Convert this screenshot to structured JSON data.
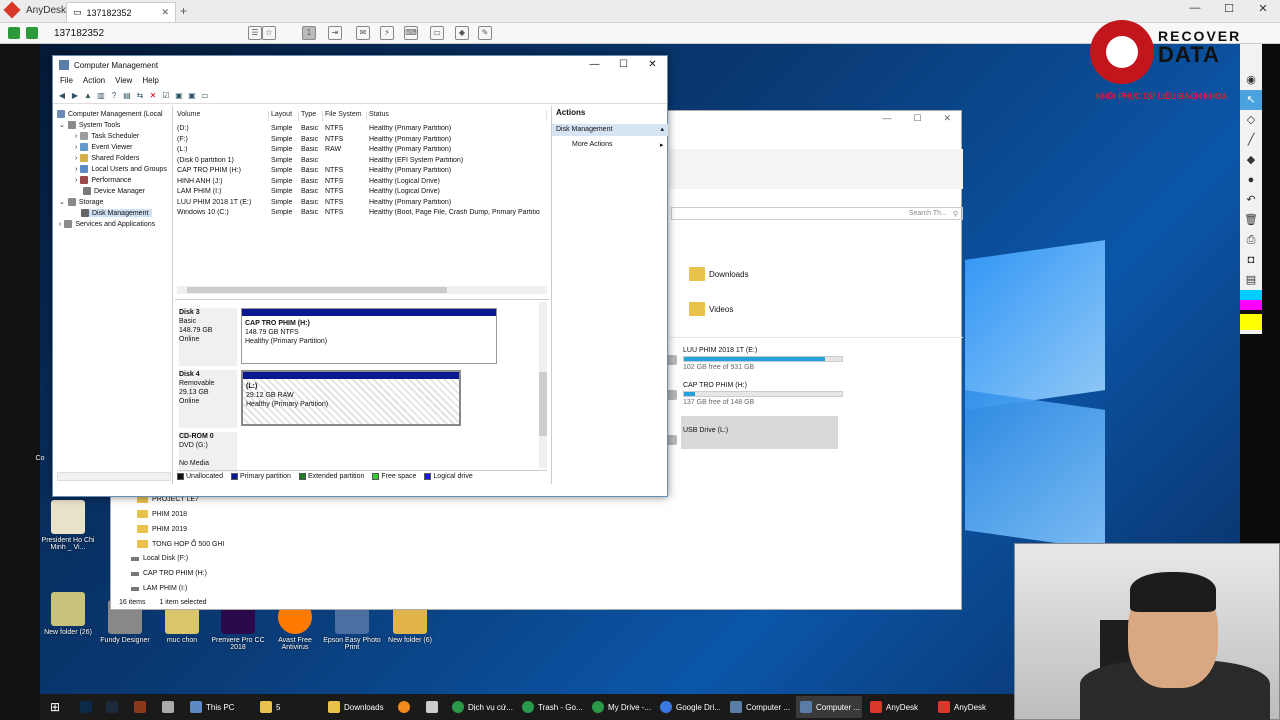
{
  "anydesk": {
    "app_name": "AnyDesk",
    "tab_label": "137182352",
    "address": "137182352",
    "plus": "+",
    "win_min": "—",
    "win_max": "☐",
    "win_close": "✕"
  },
  "logo": {
    "line1": "RECOVER",
    "line2": "DATA",
    "tagline": "KHÔI PHỤC DỮ LIỆU BÁCH KHOA"
  },
  "cm": {
    "title": "Computer Management",
    "menu": [
      "File",
      "Action",
      "View",
      "Help"
    ],
    "tree": [
      {
        "label": "Computer Management (Local",
        "indent": 0
      },
      {
        "label": "System Tools",
        "indent": 1
      },
      {
        "label": "Task Scheduler",
        "indent": 2
      },
      {
        "label": "Event Viewer",
        "indent": 2
      },
      {
        "label": "Shared Folders",
        "indent": 2
      },
      {
        "label": "Local Users and Groups",
        "indent": 2
      },
      {
        "label": "Performance",
        "indent": 2
      },
      {
        "label": "Device Manager",
        "indent": 2
      },
      {
        "label": "Storage",
        "indent": 1
      },
      {
        "label": "Disk Management",
        "indent": 2
      },
      {
        "label": "Services and Applications",
        "indent": 1
      }
    ],
    "columns": [
      "Volume",
      "Layout",
      "Type",
      "File System",
      "Status"
    ],
    "volumes": [
      [
        "(D:)",
        "Simple",
        "Basic",
        "NTFS",
        "Healthy (Primary Partition)"
      ],
      [
        "(F:)",
        "Simple",
        "Basic",
        "NTFS",
        "Healthy (Primary Partition)"
      ],
      [
        "(L:)",
        "Simple",
        "Basic",
        "RAW",
        "Healthy (Primary Partition)"
      ],
      [
        "(Disk 0 partition 1)",
        "Simple",
        "Basic",
        "",
        "Healthy (EFI System Partition)"
      ],
      [
        "CAP TRO PHIM (H:)",
        "Simple",
        "Basic",
        "NTFS",
        "Healthy (Primary Partition)"
      ],
      [
        "HINH ANH (J:)",
        "Simple",
        "Basic",
        "NTFS",
        "Healthy (Logical Drive)"
      ],
      [
        "LAM PHIM (I:)",
        "Simple",
        "Basic",
        "NTFS",
        "Healthy (Logical Drive)"
      ],
      [
        "LUU PHIM 2018 1T (E:)",
        "Simple",
        "Basic",
        "NTFS",
        "Healthy (Primary Partition)"
      ],
      [
        "Windows 10 (C:)",
        "Simple",
        "Basic",
        "NTFS",
        "Healthy (Boot, Page File, Crash Dump, Primary Partitio"
      ]
    ],
    "disks": [
      {
        "name": "Disk 3",
        "type": "Basic",
        "size": "148.79 GB",
        "state": "Online",
        "part_name": "CAP TRO PHIM (H:)",
        "part_size": "148.79 GB NTFS",
        "part_status": "Healthy (Primary Partition)"
      },
      {
        "name": "Disk 4",
        "type": "Removable",
        "size": "29.13 GB",
        "state": "Online",
        "part_name": "(L:)",
        "part_size": "29.12 GB RAW",
        "part_status": "Healthy (Primary Partition)"
      },
      {
        "name": "CD-ROM 0",
        "type": "DVD (G:)",
        "size": "",
        "state": "No Media"
      }
    ],
    "legend": [
      {
        "label": "Unallocated",
        "color": "#111111"
      },
      {
        "label": "Primary partition",
        "color": "#0a1a8e"
      },
      {
        "label": "Extended partition",
        "color": "#1e7e1e"
      },
      {
        "label": "Free space",
        "color": "#33cc33"
      },
      {
        "label": "Logical drive",
        "color": "#1a1aee"
      }
    ],
    "actions_title": "Actions",
    "actions_section": "Disk Management",
    "actions_more": "More Actions"
  },
  "explorer": {
    "search_placeholder": "Search Th...",
    "folders": [
      "Downloads",
      "Videos"
    ],
    "drives": [
      {
        "name": "LUU PHIM 2018  1T (E:)",
        "free": "102 GB free of 931 GB",
        "used": 0.89
      },
      {
        "name": "CAP TRO PHIM (H:)",
        "free": "137 GB free of 148 GB",
        "used": 0.07
      },
      {
        "name": "USB Drive (L:)",
        "free": "",
        "used": 0
      }
    ],
    "left_tree": [
      "PROJECT LE7",
      "PHIM 2018",
      "PHIM 2019",
      "TONG HOP Ổ 500 GHI",
      "Local Disk (F:)",
      "CAP TRO PHIM (H:)",
      "LAM PHIM  (I:)"
    ],
    "status_items": "16 items",
    "status_selected": "1 item selected"
  },
  "desktop_icons": [
    {
      "label": "President Ho Chi Minh _ Vi..."
    },
    {
      "label": "Co"
    },
    {
      "label": "New folder (26)"
    },
    {
      "label": "Fundy Designer"
    },
    {
      "label": "muc chon"
    },
    {
      "label": "Premiere Pro CC 2018"
    },
    {
      "label": "Avast Free Antivirus"
    },
    {
      "label": "Epson Easy Photo Print"
    },
    {
      "label": "New folder (6)"
    }
  ],
  "taskbar": [
    "This PC",
    "5",
    "Downloads",
    "Dịch vụ cứ...",
    "Trash - Go...",
    "My Drive -...",
    "Google Dri...",
    "Computer ...",
    "Computer ...",
    "AnyDesk",
    "AnyDesk"
  ]
}
